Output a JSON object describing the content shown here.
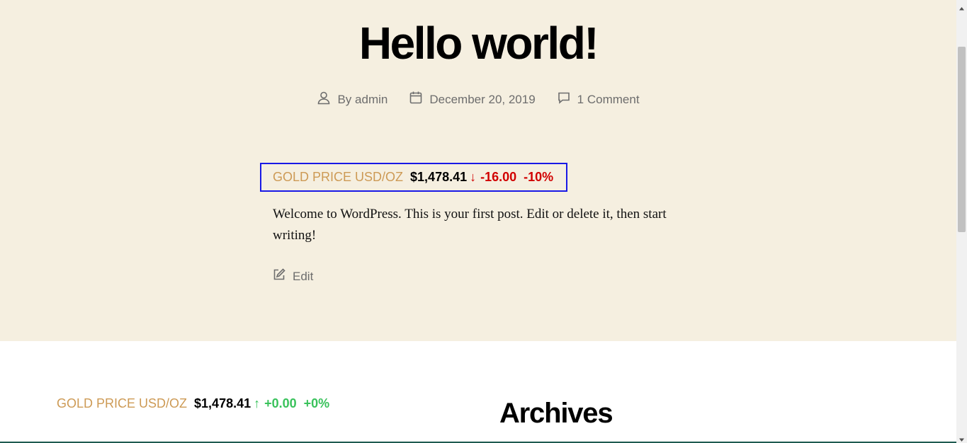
{
  "post": {
    "title": "Hello world!",
    "meta": {
      "author_prefix": "By",
      "author": "admin",
      "date": "December 20, 2019",
      "comments": "1 Comment"
    },
    "ticker": {
      "label": "GOLD PRICE USD/OZ",
      "price": "$1,478.41",
      "arrow": "↓",
      "change": "-16.00",
      "percent": "-10%",
      "direction": "down",
      "color": "#d10000"
    },
    "content": "Welcome to WordPress. This is your first post. Edit or delete it, then start writing!",
    "edit_label": "Edit"
  },
  "footer": {
    "ticker": {
      "label": "GOLD PRICE USD/OZ",
      "price": "$1,478.41",
      "arrow": "↑",
      "change": "+0.00",
      "percent": "+0%",
      "direction": "up",
      "color": "#39c25b"
    },
    "archives_heading": "Archives"
  },
  "colors": {
    "post_background": "#f5efe0",
    "accent_label": "#cd9a55",
    "highlight_border": "#1919e6"
  },
  "icons": {
    "author": "user-icon",
    "date": "calendar-icon",
    "comments": "comment-icon",
    "edit": "edit-icon"
  }
}
